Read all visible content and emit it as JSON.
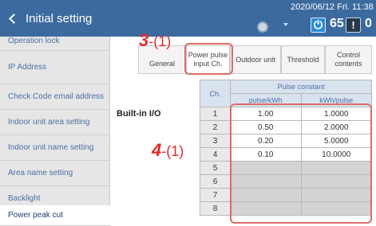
{
  "header": {
    "back_label": "Initial setting",
    "datetime": "2020/06/12 Fri. 11:38",
    "power_count": "65",
    "warning_count": "0"
  },
  "sidebar": {
    "items": [
      {
        "label": "Operation lock",
        "active": false
      },
      {
        "label": "IP Address",
        "active": false
      },
      {
        "label": "Check Code email address",
        "active": false
      },
      {
        "label": "Indoor unit area setting",
        "active": false
      },
      {
        "label": "Indoor unit name setting",
        "active": false
      },
      {
        "label": "Area name setting",
        "active": false
      },
      {
        "label": "Backlight",
        "active": false
      },
      {
        "label": "Power peak cut",
        "active": true
      }
    ]
  },
  "tabs": {
    "general": "General",
    "power_pulse": "Power pulse input Ch.",
    "outdoor_unit": "Outdoor unit",
    "threshold": "Threshold",
    "control_contents": "Control contents"
  },
  "annotations": {
    "tab_marker_num": "3",
    "tab_marker_sub": "-(1)",
    "table_marker_num": "4",
    "table_marker_sub": "-(1)"
  },
  "section_label": "Built-in I/O",
  "table": {
    "ch_header": "Ch.",
    "group_header": "Pulse constant",
    "col1_header": "pulse/kWh",
    "col2_header": "kWh/pulse",
    "rows": [
      {
        "ch": "1",
        "pulse": "1.00",
        "kwh": "1.0000"
      },
      {
        "ch": "2",
        "pulse": "0.50",
        "kwh": "2.0000"
      },
      {
        "ch": "3",
        "pulse": "0.20",
        "kwh": "5.0000"
      },
      {
        "ch": "4",
        "pulse": "0.10",
        "kwh": "10.0000"
      },
      {
        "ch": "5",
        "pulse": "",
        "kwh": ""
      },
      {
        "ch": "6",
        "pulse": "",
        "kwh": ""
      },
      {
        "ch": "7",
        "pulse": "",
        "kwh": ""
      },
      {
        "ch": "8",
        "pulse": "",
        "kwh": ""
      }
    ]
  },
  "colors": {
    "header_bg": "#3c6a9f",
    "annotation_red": "#e32a2a",
    "sidebar_text": "#4a6fa5"
  }
}
